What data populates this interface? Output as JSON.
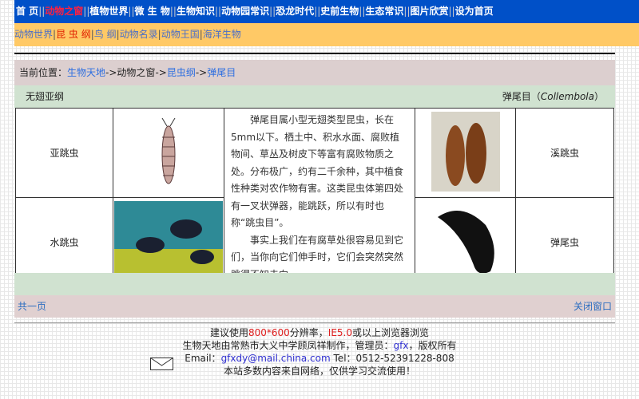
{
  "nav": {
    "items": [
      "首 页",
      "动物之窗",
      "植物世界",
      "微 生 物",
      "生物知识",
      "动物园常识",
      "恐龙时代",
      "史前生物",
      "生态常识",
      "图片欣赏",
      "设为首页"
    ]
  },
  "subnav": {
    "items": [
      "动物世界",
      "昆 虫 纲",
      "鸟 纲",
      "动物名录",
      "动物王国",
      "海洋生物"
    ]
  },
  "breadcrumb": {
    "label": "当前位置：",
    "items": [
      "生物天地",
      "动物之窗",
      "昆虫纲",
      "弹尾目"
    ],
    "sep": "->"
  },
  "band": {
    "left": "无翅亚纲",
    "right": "弹尾目（",
    "latin": "Collembola",
    "right_end": "）"
  },
  "table": {
    "r1_left": "亚跳虫",
    "r1_right": "溪跳虫",
    "r2_left": "水跳虫",
    "r2_right": "弹尾虫",
    "p1": "弹尾目属小型无翅类型昆虫，长在5mm以下。栖土中、积水水面、腐败植物间、草丛及树皮下等富有腐败物质之处。分布极广，约有二千余种，其中植食性种类对农作物有害。这类昆虫体第四处有一叉状弹器，能跳跃，所以有时也称“跳虫目”。",
    "p2": "事实上我们在有腐草处很容易见到它们，当你向它们伸手时，它们会突然突然跳得不知去向。"
  },
  "footer": {
    "pages": "共一页",
    "close": "关闭窗口"
  },
  "info": {
    "l1a": "建议使用",
    "l1b": "800*600",
    "l1c": "分辨率，",
    "l1d": "IE5.0",
    "l1e": "或以上浏览器浏览",
    "l2a": "生物天地由常熟市大义中学顾凤祥制作，管理员：",
    "l2b": "gfx",
    "l2c": "，版权所有",
    "l3a": "Email：",
    "l3b": "gfxdy@mail.china.com",
    "l3c": " Tel：0512-52391228-808",
    "l4": "本站多数内容来自网络，仅供学习交流使用！"
  }
}
